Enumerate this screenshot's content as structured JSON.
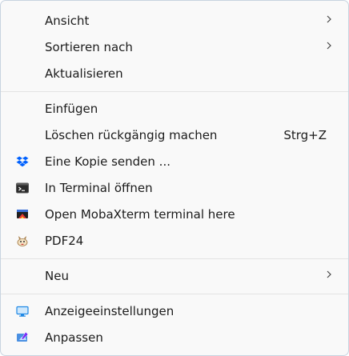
{
  "menu": {
    "view_label": "Ansicht",
    "sort_label": "Sortieren nach",
    "refresh_label": "Aktualisieren",
    "paste_label": "Einfügen",
    "undo_delete_label": "Löschen rückgängig machen",
    "undo_delete_shortcut": "Strg+Z",
    "send_copy_label": "Eine Kopie senden ...",
    "open_terminal_label": "In Terminal öffnen",
    "mobaxterm_label": "Open MobaXterm terminal here",
    "pdf24_label": "PDF24",
    "new_label": "Neu",
    "display_settings_label": "Anzeigeeinstellungen",
    "personalize_label": "Anpassen"
  },
  "icons": {
    "submenu": "chevron-right-icon",
    "send_copy": "dropbox-icon",
    "terminal": "terminal-icon",
    "mobaxterm": "mobaxterm-icon",
    "pdf24": "pdf24-icon",
    "display": "display-icon",
    "personalize": "personalize-icon"
  },
  "colors": {
    "background": "#f9f9f9",
    "border": "#c8d4e0",
    "text": "#1b1b1b",
    "separator": "#e3e3e3",
    "dropbox_blue": "#0061fe",
    "display_blue": "#1e88e5"
  }
}
